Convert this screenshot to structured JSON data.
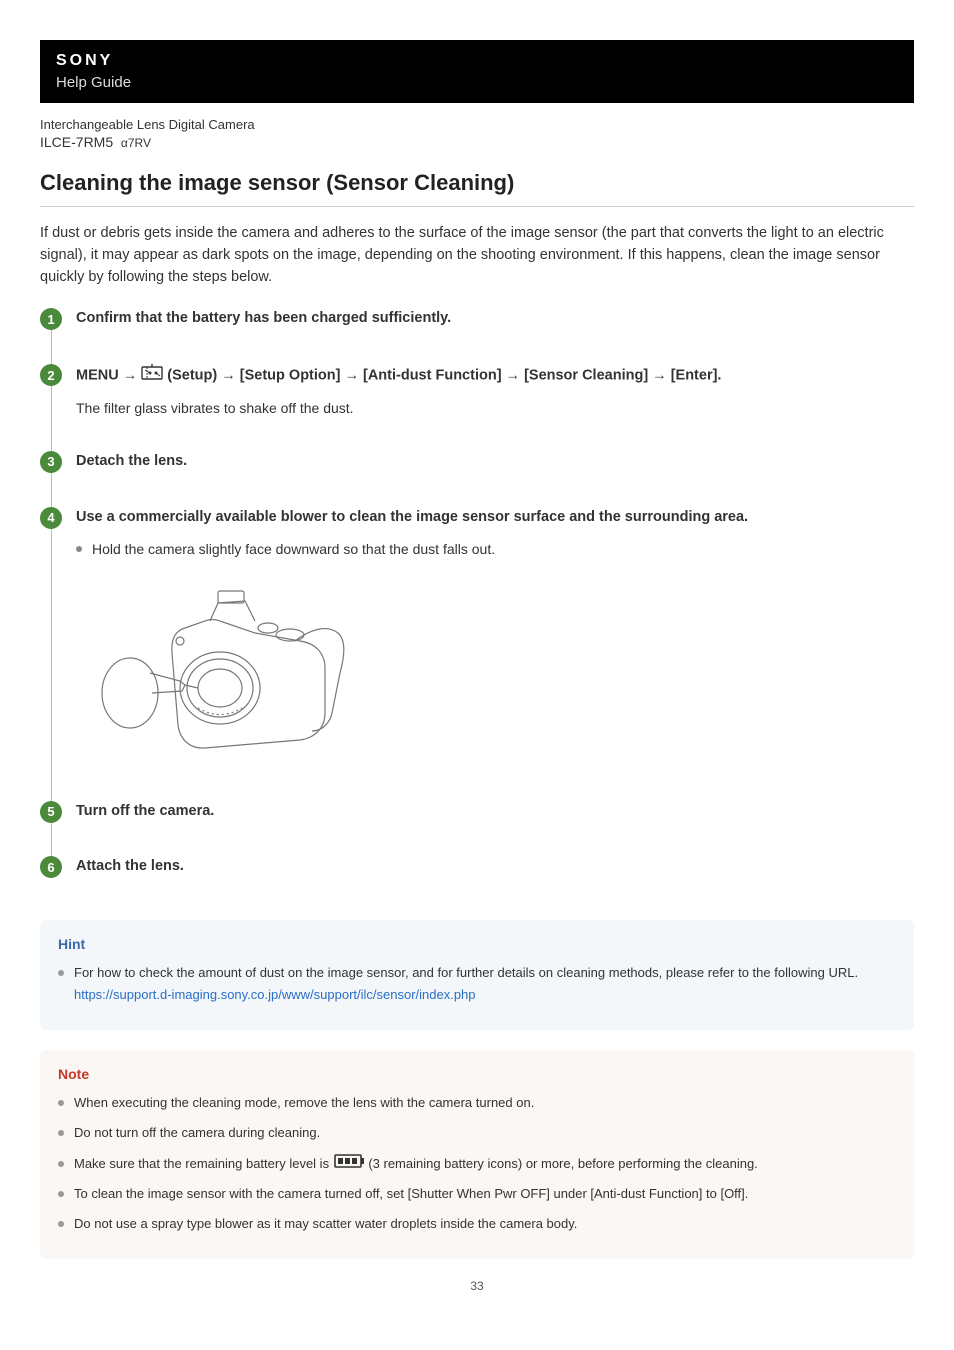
{
  "header": {
    "brand": "SONY",
    "help_guide": "Help Guide"
  },
  "product": {
    "category": "Interchangeable Lens Digital Camera",
    "model_main": "ILCE-7RM5",
    "model_suffix": "α7RV"
  },
  "page_title": "Cleaning the image sensor (Sensor Cleaning)",
  "intro": "If dust or debris gets inside the camera and adheres to the surface of the image sensor (the part that converts the light to an electric signal), it may appear as dark spots on the image, depending on the shooting environment. If this happens, clean the image sensor quickly by following the steps below.",
  "steps": [
    {
      "num": "1",
      "title": "Confirm that the battery has been charged sufficiently."
    },
    {
      "num": "2",
      "title_prefix": "MENU → ",
      "title_after_icon": " (Setup) → [Setup Option] → [Anti-dust Function] → [Sensor Cleaning] → [Enter].",
      "desc": "The filter glass vibrates to shake off the dust."
    },
    {
      "num": "3",
      "title": "Detach the lens."
    },
    {
      "num": "4",
      "title": "Use a commercially available blower to clean the image sensor surface and the surrounding area.",
      "bullets": [
        "Hold the camera slightly face downward so that the dust falls out."
      ]
    },
    {
      "num": "5",
      "title": "Turn off the camera."
    },
    {
      "num": "6",
      "title": "Attach the lens."
    }
  ],
  "hint": {
    "title": "Hint",
    "items": [
      {
        "text": "For how to check the amount of dust on the image sensor, and for further details on cleaning methods, please refer to the following URL.",
        "link": "https://support.d-imaging.sony.co.jp/www/support/ilc/sensor/index.php"
      }
    ]
  },
  "note": {
    "title": "Note",
    "items": [
      "When executing the cleaning mode, remove the lens with the camera turned on.",
      "Do not turn off the camera during cleaning.",
      {
        "prefix": "Make sure that the remaining battery level is ",
        "suffix": " (3 remaining battery icons) or more, before performing the cleaning."
      },
      "To clean the image sensor with the camera turned off, set [Shutter When Pwr OFF] under [Anti-dust Function] to [Off].",
      "Do not use a spray type blower as it may scatter water droplets inside the camera body."
    ]
  },
  "page_number": "33"
}
